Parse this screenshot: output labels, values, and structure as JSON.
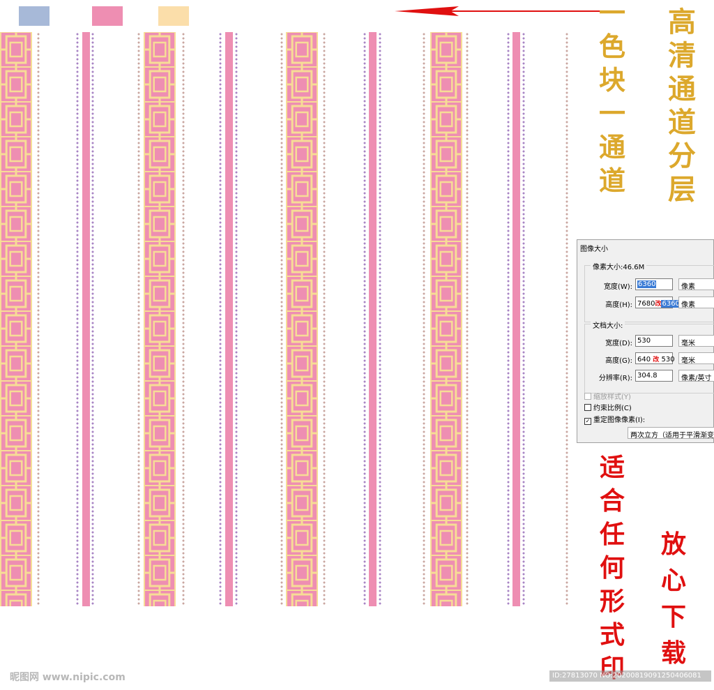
{
  "swatches": {
    "colors": [
      "#a7b9d8",
      "#ee8eb2",
      "#fbdeaa"
    ]
  },
  "pattern": {
    "pink": "#ee8eb2",
    "gold": "#f7dc96",
    "purple_dot": "#a884c4",
    "tan_dot": "#c9a6a0"
  },
  "annotations": {
    "gold_title": [
      "高",
      "清",
      "通",
      "道",
      "分",
      "层"
    ],
    "gold_subtitle": [
      "一",
      "色",
      "块",
      "一",
      "通",
      "道"
    ],
    "red_left": [
      "适",
      "合",
      "任",
      "何",
      "形",
      "式",
      "印"
    ],
    "red_right": [
      "放",
      "心",
      "下",
      "载"
    ],
    "arrow_color": "#e01010"
  },
  "dialog": {
    "title": "图像大小",
    "pixel_group_label": "像素大小:46.6M",
    "width_label": "宽度(W):",
    "width_value": "6360",
    "width_unit": "像素",
    "height_label": "高度(H):",
    "height_value_old": "7680",
    "height_mark": "改",
    "height_value_new": "6360",
    "height_unit": "像素",
    "doc_group_label": "文档大小:",
    "doc_width_label": "宽度(D):",
    "doc_width_value": "530",
    "doc_width_unit": "毫米",
    "doc_height_label": "高度(G):",
    "doc_height_value_old": "640",
    "doc_height_mark": "改",
    "doc_height_value_new": "530",
    "doc_height_unit": "毫米",
    "resolution_label": "分辨率(R):",
    "resolution_value": "304.8",
    "resolution_unit": "像素/英寸",
    "scale_styles_label": "缩放样式(Y)",
    "constrain_label": "约束比例(C)",
    "resample_label": "重定图像像素(I):",
    "resample_value": "两次立方（适用于平滑渐变"
  },
  "watermarks": {
    "left": "昵图网 www.nipic.com",
    "right": "ID:27813070 NO:20200819091250406081"
  }
}
